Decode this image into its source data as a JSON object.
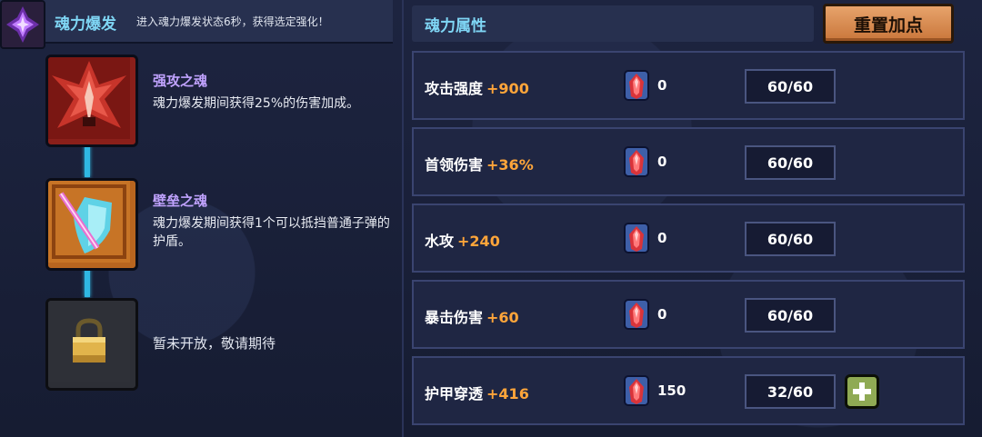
{
  "left_panel": {
    "title": "魂力爆发",
    "subtitle": "进入魂力爆发状态6秒，获得选定强化！",
    "emblem_icon": "purple-crystal-icon",
    "skills": [
      {
        "name": "强攻之魂",
        "desc": "魂力爆发期间获得25%的伤害加成。",
        "icon": "red-spiked-crest-icon"
      },
      {
        "name": "壁垒之魂",
        "desc": "魂力爆发期间获得1个可以抵挡普通子弹的护盾。",
        "icon": "shield-sword-icon"
      }
    ],
    "locked_slot": {
      "icon": "padlock-icon",
      "text": "暂未开放，敬请期待"
    },
    "connector_color": "#2fb8e3"
  },
  "right_panel": {
    "title": "魂力属性",
    "reset_label": "重置加点",
    "stats": [
      {
        "name": "攻击强度",
        "bonus": "+900",
        "crystals": "0",
        "level": "60/60",
        "can_add": false
      },
      {
        "name": "首领伤害",
        "bonus": "+36%",
        "crystals": "0",
        "level": "60/60",
        "can_add": false
      },
      {
        "name": "水攻",
        "bonus": "+240",
        "crystals": "0",
        "level": "60/60",
        "can_add": false
      },
      {
        "name": "暴击伤害",
        "bonus": "+60",
        "crystals": "0",
        "level": "60/60",
        "can_add": false
      },
      {
        "name": "护甲穿透",
        "bonus": "+416",
        "crystals": "150",
        "level": "32/60",
        "can_add": true
      }
    ],
    "crystal_icon": "soul-crystal-icon",
    "plus_icon": "plus-icon"
  },
  "colors": {
    "accent_title": "#7fd6f5",
    "bonus": "#ffa53a",
    "skill_name": "#c1a3ff",
    "reset_button": "#d98a4f",
    "plus_button": "#8faa54"
  }
}
